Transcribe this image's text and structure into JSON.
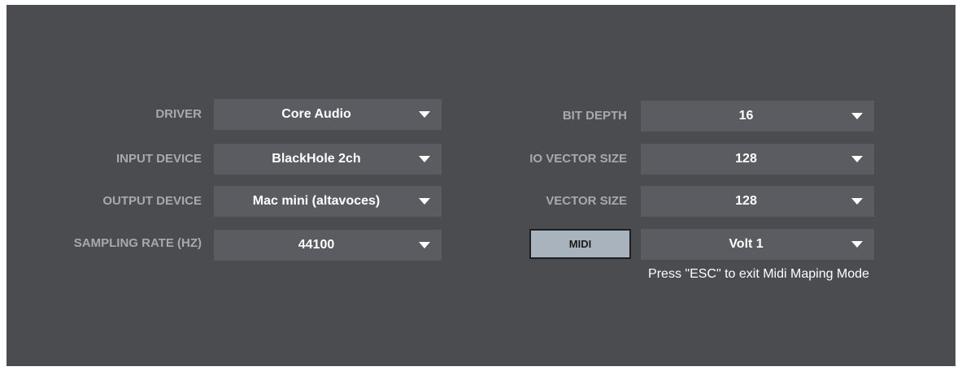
{
  "left_settings": [
    {
      "label": "DRIVER",
      "value": "Core Audio"
    },
    {
      "label": "INPUT DEVICE",
      "value": "BlackHole 2ch"
    },
    {
      "label": "OUTPUT DEVICE",
      "value": "Mac mini (altavoces)"
    },
    {
      "label": "SAMPLING RATE (HZ)",
      "value": "44100"
    }
  ],
  "right_settings": [
    {
      "label": "BIT DEPTH",
      "value": "16"
    },
    {
      "label": "IO VECTOR SIZE",
      "value": "128"
    },
    {
      "label": "VECTOR SIZE",
      "value": "128"
    }
  ],
  "midi": {
    "button_label": "MIDI",
    "device_value": "Volt 1",
    "hint": "Press \"ESC\" to exit Midi Maping Mode"
  },
  "icons": {
    "dropdown": "chevron-down-icon"
  },
  "colors": {
    "background": "#4a4c50",
    "field": "#5a5c61",
    "label": "#a7a9ac",
    "midi_button": "#a9b3bd"
  }
}
